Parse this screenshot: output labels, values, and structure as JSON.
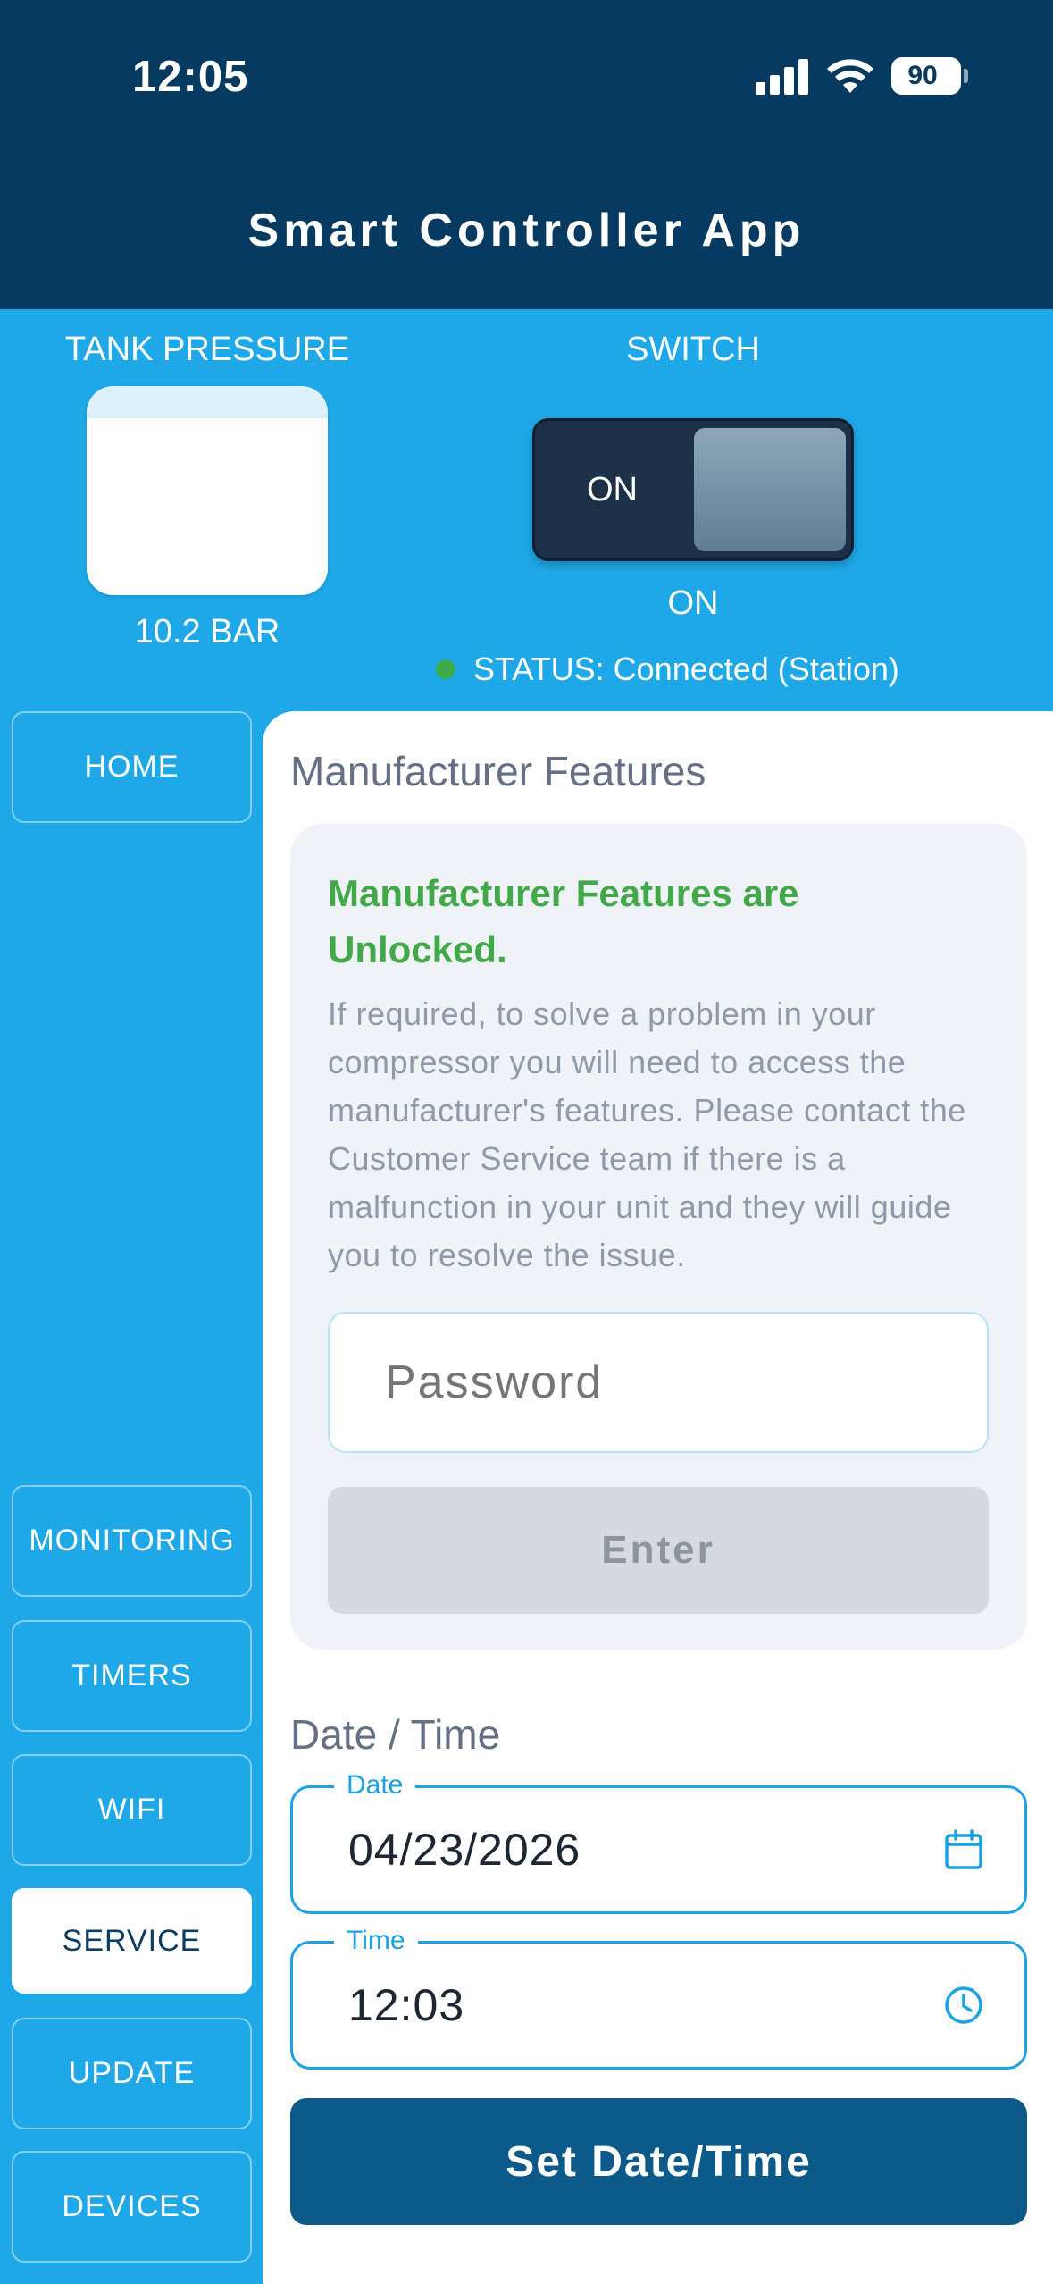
{
  "status_bar": {
    "time": "12:05",
    "battery": "90"
  },
  "header": {
    "title": "Smart Controller App"
  },
  "tank": {
    "label": "TANK PRESSURE",
    "value": "10.2 BAR"
  },
  "switch": {
    "label": "SWITCH",
    "toggle_text": "ON",
    "state_text": "ON"
  },
  "status": {
    "text": "STATUS: Connected (Station)",
    "dot_color": "#3cab4a"
  },
  "sidebar": {
    "items": [
      {
        "label": "HOME"
      },
      {
        "label": "MONITORING"
      },
      {
        "label": "TIMERS"
      },
      {
        "label": "WIFI"
      },
      {
        "label": "SERVICE",
        "active": true
      },
      {
        "label": "UPDATE"
      },
      {
        "label": "DEVICES"
      }
    ]
  },
  "manufacturer": {
    "title": "Manufacturer Features",
    "unlocked_text": "Manufacturer Features are Unlocked.",
    "description": "If required, to solve a problem in your compressor you will need to access the manufacturer's features. Please contact the Customer Service team if there is a malfunction in your unit and they will guide you to resolve the issue.",
    "password_placeholder": "Password",
    "enter_label": "Enter"
  },
  "datetime": {
    "title": "Date / Time",
    "date_label": "Date",
    "date_value": "04/23/2026",
    "time_label": "Time",
    "time_value": "12:03",
    "set_label": "Set Date/Time"
  },
  "colors": {
    "header": "#073a60",
    "panel": "#1fa8e8",
    "accent": "#1da1e2",
    "primary_button": "#0b5a8a",
    "success": "#43a848"
  }
}
